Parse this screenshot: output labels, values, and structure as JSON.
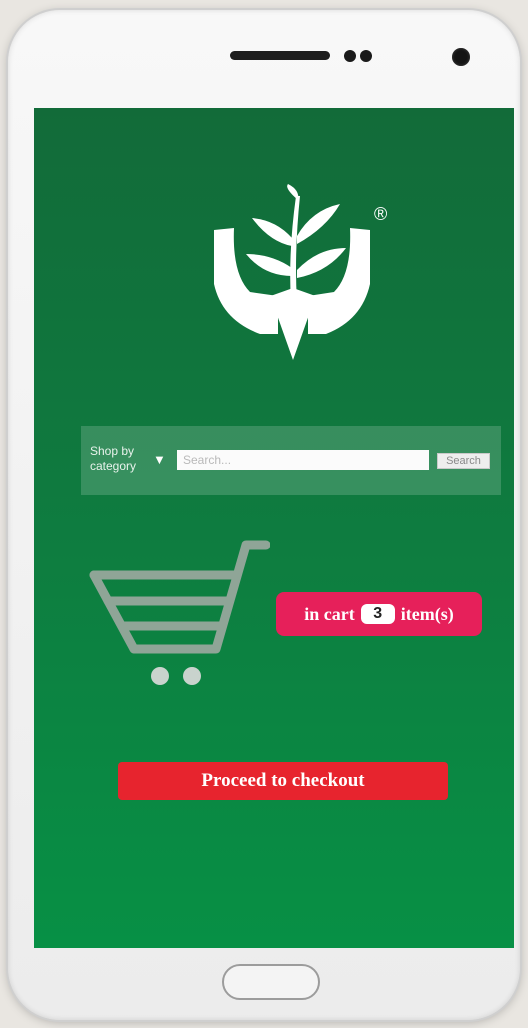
{
  "logo": {
    "icon": "leaf-in-hands-logo",
    "registered_mark": "®"
  },
  "search": {
    "category_label": "Shop by category",
    "dropdown_icon": "▼",
    "placeholder": "Search...",
    "button_label": "Search"
  },
  "cart": {
    "icon": "shopping-cart-icon",
    "prefix": "in cart",
    "count": "3",
    "suffix": "item(s)"
  },
  "checkout": {
    "label": "Proceed to checkout"
  },
  "colors": {
    "screen_top": "#126b39",
    "screen_bottom": "#079045",
    "cart_badge": "#e6205a",
    "checkout_button": "#e7242e",
    "cart_icon": "#8fa597"
  }
}
